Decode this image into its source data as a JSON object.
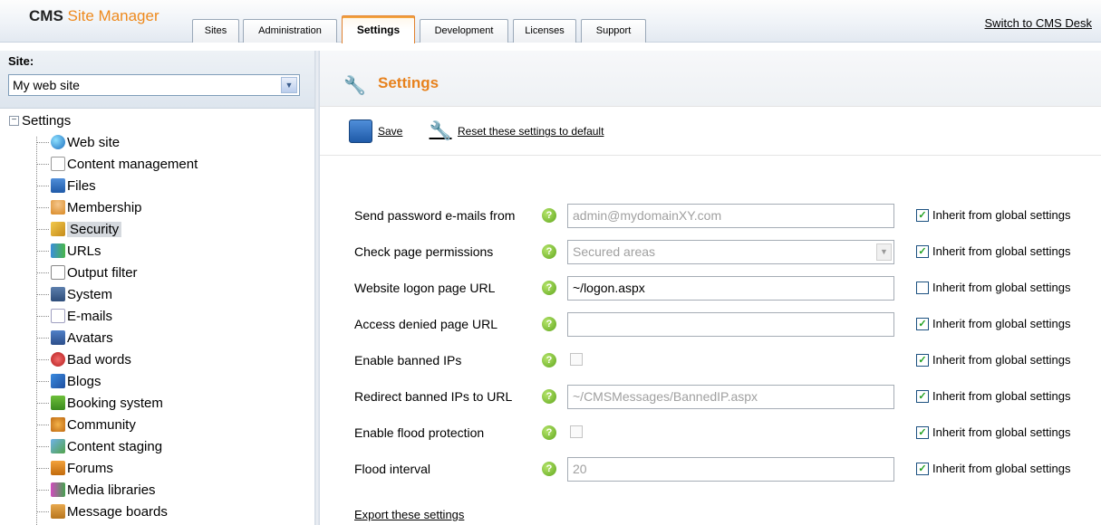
{
  "app": {
    "title_primary": "CMS",
    "title_accent": "Site Manager",
    "switch_link": "Switch to CMS Desk"
  },
  "tabs": [
    {
      "label": "Sites"
    },
    {
      "label": "Administration"
    },
    {
      "label": "Settings",
      "active": true
    },
    {
      "label": "Development"
    },
    {
      "label": "Licenses"
    },
    {
      "label": "Support"
    }
  ],
  "site": {
    "label": "Site:",
    "value": "My web site"
  },
  "tree": {
    "root": "Settings",
    "items": [
      {
        "label": "Web site",
        "icon": "globe-icon"
      },
      {
        "label": "Content management",
        "icon": "edit-page-icon"
      },
      {
        "label": "Files",
        "icon": "floppy-icon"
      },
      {
        "label": "Membership",
        "icon": "user-icon"
      },
      {
        "label": "Security",
        "icon": "keys-icon",
        "selected": true
      },
      {
        "label": "URLs",
        "icon": "network-icon"
      },
      {
        "label": "Output filter",
        "icon": "funnel-icon"
      },
      {
        "label": "System",
        "icon": "monitor-icon"
      },
      {
        "label": "E-mails",
        "icon": "envelope-icon"
      },
      {
        "label": "Avatars",
        "icon": "avatar-icon"
      },
      {
        "label": "Bad words",
        "icon": "bad-words-icon"
      },
      {
        "label": "Blogs",
        "icon": "blog-icon"
      },
      {
        "label": "Booking system",
        "icon": "booking-icon"
      },
      {
        "label": "Community",
        "icon": "community-icon"
      },
      {
        "label": "Content staging",
        "icon": "staging-icon"
      },
      {
        "label": "Forums",
        "icon": "forum-icon"
      },
      {
        "label": "Media libraries",
        "icon": "media-icon"
      },
      {
        "label": "Message boards",
        "icon": "board-icon"
      }
    ]
  },
  "page": {
    "title": "Settings"
  },
  "toolbar": {
    "save": "Save",
    "reset": "Reset these settings to default"
  },
  "settings": [
    {
      "label": "Send password e-mails from",
      "type": "text",
      "value": "admin@mydomainXY.com",
      "disabled": true,
      "inherit": true
    },
    {
      "label": "Check page permissions",
      "type": "select",
      "value": "Secured areas",
      "disabled": true,
      "inherit": true
    },
    {
      "label": "Website logon page URL",
      "type": "text",
      "value": "~/logon.aspx",
      "disabled": false,
      "inherit": false
    },
    {
      "label": "Access denied page URL",
      "type": "text",
      "value": "",
      "disabled": false,
      "inherit": true
    },
    {
      "label": "Enable banned IPs",
      "type": "checkbox",
      "value": false,
      "disabled": true,
      "inherit": true
    },
    {
      "label": "Redirect banned IPs to URL",
      "type": "text",
      "value": "~/CMSMessages/BannedIP.aspx",
      "disabled": true,
      "inherit": true
    },
    {
      "label": "Enable flood protection",
      "type": "checkbox",
      "value": false,
      "disabled": true,
      "inherit": true
    },
    {
      "label": "Flood interval",
      "type": "text",
      "value": "20",
      "disabled": true,
      "inherit": true
    }
  ],
  "inherit_label": "Inherit from global settings",
  "export_link": "Export these settings",
  "colors": {
    "accent": "#e7811c",
    "help": "#5fa61c",
    "check": "#21a121"
  }
}
